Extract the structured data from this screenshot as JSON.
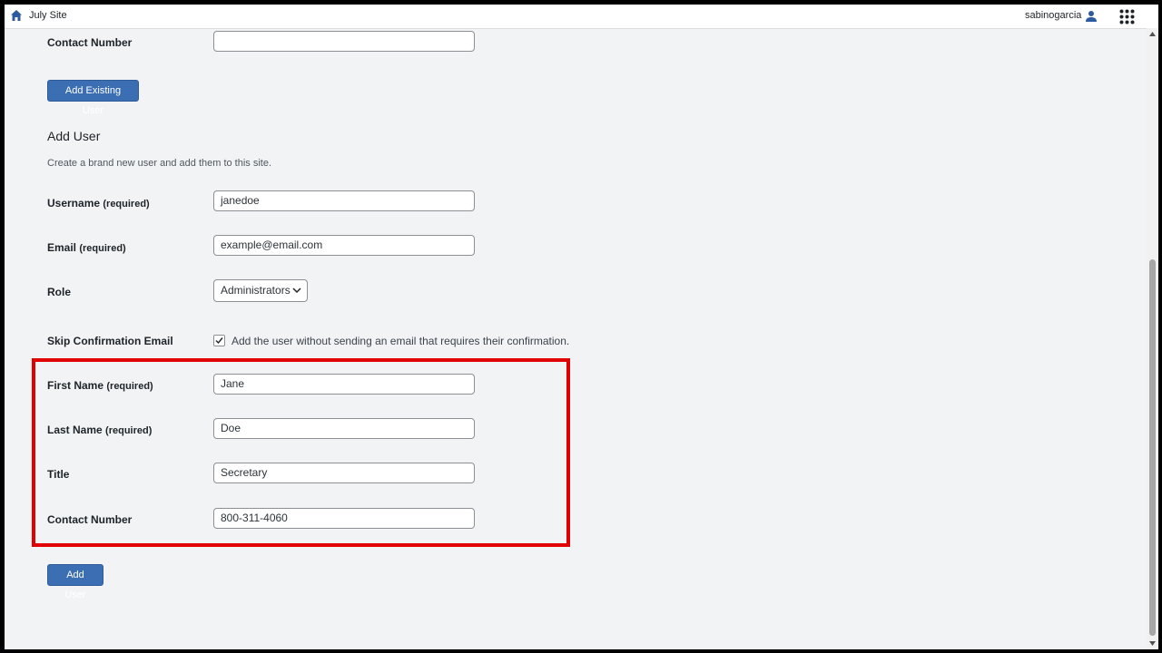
{
  "topbar": {
    "site_title": "July Site",
    "username": "sabinogarcia",
    "icons": [
      "home-icon",
      "user-icon",
      "apps-grid-icon"
    ]
  },
  "existing_user": {
    "contact_number_label": "Contact Number",
    "contact_number_value": "",
    "add_existing_button": "Add Existing User"
  },
  "add_user": {
    "title": "Add User",
    "description": "Create a brand new user and add them to this site.",
    "required_suffix": "(required)",
    "username_label": "Username",
    "username_value": "janedoe",
    "email_label": "Email",
    "email_value": "example@email.com",
    "role_label": "Role",
    "role_selected": "Administrators",
    "skip_label": "Skip Confirmation Email",
    "skip_checked": true,
    "skip_text": "Add the user without sending an email that requires their confirmation.",
    "first_name_label": "First Name",
    "first_name_value": "Jane",
    "last_name_label": "Last Name",
    "last_name_value": "Doe",
    "title_label": "Title",
    "title_value": "Secretary",
    "contact_label": "Contact Number",
    "contact_value": "800-311-4060",
    "submit_button": "Add User"
  },
  "colors": {
    "accent": "#3c6eb4",
    "highlight": "#e00000",
    "background": "#f2f3f5"
  }
}
